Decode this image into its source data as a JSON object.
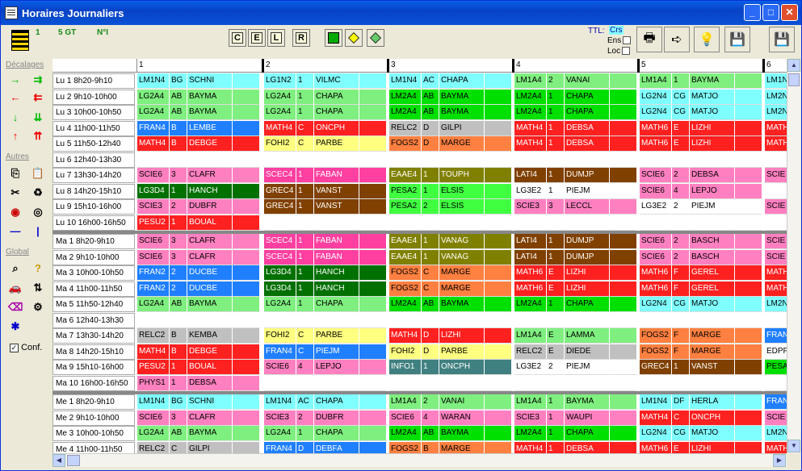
{
  "window": {
    "title": "Horaires Journaliers",
    "btn_min": "_",
    "btn_max": "□",
    "btn_close": "✕"
  },
  "toolbar": {
    "label1": "1",
    "label2": "5 GT",
    "label3": "N°I",
    "f_buttons": [
      "C",
      "E",
      "L",
      "R"
    ],
    "ttl": "TTL:",
    "crs": "Crs",
    "ens": "Ens",
    "loc": "Loc"
  },
  "left": {
    "decalages": "Décalages",
    "autres": "Autres",
    "global": "Global",
    "conf": "Conf."
  },
  "colors": {
    "cyan": "#7fffff",
    "mint": "#7fef7f",
    "green": "#00e000",
    "blue": "#1f7fff",
    "red": "#ff2020",
    "yellow": "#ffff80",
    "gray": "#c0c0c0",
    "orange": "#ff8040",
    "olive": "#808000",
    "pink": "#ff80c0",
    "dkgreen": "#007000",
    "brown": "#804000",
    "magenta": "#ff40a0",
    "teal": "#408080",
    "lgreen": "#40ff40"
  },
  "days": [
    {
      "label": "1"
    },
    {
      "label": "2"
    },
    {
      "label": "3"
    },
    {
      "label": "4"
    },
    {
      "label": "5"
    },
    {
      "label": "6"
    }
  ],
  "rows": [
    {
      "label": "Lu 1  8h20-9h10",
      "cells": [
        [
          "LM1N4",
          "BG",
          "SCHNI",
          "cyan"
        ],
        [
          "LG1N2",
          "1",
          "VILMC",
          "cyan"
        ],
        [
          "LM1N4",
          "AC",
          "CHAPA",
          "cyan"
        ],
        [
          "LM1A4",
          "2",
          "VANAI",
          "mint"
        ],
        [
          "LM1A4",
          "1",
          "BAYMA",
          "mint"
        ],
        [
          "LM1N",
          "",
          "",
          "cyan"
        ]
      ]
    },
    {
      "label": "Lu 2  9h10-10h00",
      "cells": [
        [
          "LG2A4",
          "AB",
          "BAYMA",
          "mint"
        ],
        [
          "LG2A4",
          "1",
          "CHAPA",
          "mint"
        ],
        [
          "LM2A4",
          "AB",
          "BAYMA",
          "green"
        ],
        [
          "LM2A4",
          "1",
          "CHAPA",
          "green"
        ],
        [
          "LG2N4",
          "CG",
          "MATJO",
          "cyan"
        ],
        [
          "LM2N",
          "",
          "",
          "cyan"
        ]
      ]
    },
    {
      "label": "Lu 3  10h00-10h50",
      "cells": [
        [
          "LG2A4",
          "AB",
          "BAYMA",
          "mint"
        ],
        [
          "LG2A4",
          "1",
          "CHAPA",
          "mint"
        ],
        [
          "LM2A4",
          "AB",
          "BAYMA",
          "green"
        ],
        [
          "LM2A4",
          "1",
          "CHAPA",
          "green"
        ],
        [
          "LG2N4",
          "CG",
          "MATJO",
          "cyan"
        ],
        [
          "LM2N",
          "",
          "",
          "cyan"
        ]
      ]
    },
    {
      "label": "Lu 4  11h00-11h50",
      "cells": [
        [
          "FRAN4",
          "B",
          "LEMBE",
          "blue"
        ],
        [
          "MATH4",
          "C",
          "ONCPH",
          "red"
        ],
        [
          "RELC2",
          "D",
          "GILPI",
          "gray"
        ],
        [
          "MATH4",
          "1",
          "DEBSA",
          "red"
        ],
        [
          "MATH6",
          "E",
          "LIZHI",
          "red"
        ],
        [
          "MATH",
          "",
          "",
          "red"
        ]
      ]
    },
    {
      "label": "Lu 5  11h50-12h40",
      "cells": [
        [
          "MATH4",
          "B",
          "DEBGE",
          "red"
        ],
        [
          "FOHI2",
          "C",
          "PARBE",
          "yellow"
        ],
        [
          "FOGS2",
          "D",
          "MARGE",
          "orange"
        ],
        [
          "MATH4",
          "1",
          "DEBSA",
          "red"
        ],
        [
          "MATH6",
          "E",
          "LIZHI",
          "red"
        ],
        [
          "MATH",
          "",
          "",
          "red"
        ]
      ]
    },
    {
      "label": "Lu 6  12h40-13h30",
      "cells": [
        [
          "",
          "",
          "",
          ""
        ],
        [
          "",
          "",
          "",
          ""
        ],
        [
          "",
          "",
          "",
          ""
        ],
        [
          "",
          "",
          "",
          ""
        ],
        [
          "",
          "",
          "",
          ""
        ],
        [
          "",
          "",
          "",
          ""
        ]
      ]
    },
    {
      "label": "Lu 7  13h30-14h20",
      "cells": [
        [
          "SCIE6",
          "3",
          "CLAFR",
          "pink"
        ],
        [
          "SCEC4",
          "1",
          "FABAN",
          "magenta"
        ],
        [
          "EAAE4",
          "1",
          "TOUPH",
          "olive"
        ],
        [
          "LATI4",
          "1",
          "DUMJP",
          "brown"
        ],
        [
          "SCIE6",
          "2",
          "DEBSA",
          "pink"
        ],
        [
          "SCIE",
          "",
          "",
          "pink"
        ]
      ]
    },
    {
      "label": "Lu 8  14h20-15h10",
      "cells": [
        [
          "LG3D4",
          "1",
          "HANCH",
          "dkgreen"
        ],
        [
          "GREC4",
          "1",
          "VANST",
          "brown"
        ],
        [
          "PESA2",
          "1",
          "ELSIS",
          "lgreen"
        ],
        [
          "LG3E2",
          "1",
          "PIEJM",
          ""
        ],
        [
          "SCIE6",
          "4",
          "LEPJO",
          "pink"
        ],
        [
          "",
          "",
          "",
          ""
        ]
      ]
    },
    {
      "label": "Lu 9  15h10-16h00",
      "cells": [
        [
          "SCIE3",
          "2",
          "DUBFR",
          "pink"
        ],
        [
          "GREC4",
          "1",
          "VANST",
          "brown"
        ],
        [
          "PESA2",
          "2",
          "ELSIS",
          "lgreen"
        ],
        [
          "SCIE3",
          "3",
          "LECCL",
          "pink"
        ],
        [
          "LG3E2",
          "2",
          "PIEJM",
          ""
        ],
        [
          "SCIE",
          "",
          "",
          "pink"
        ]
      ]
    },
    {
      "label": "Lu 10 16h00-16h50",
      "cells": [
        [
          "PESU2",
          "1",
          "BOUAL",
          "red"
        ],
        [
          "",
          "",
          "",
          ""
        ],
        [
          "",
          "",
          "",
          ""
        ],
        [
          "",
          "",
          "",
          ""
        ],
        [
          "",
          "",
          "",
          ""
        ],
        [
          "",
          "",
          "",
          ""
        ]
      ]
    },
    {
      "label": "Ma 1  8h20-9h10",
      "cells": [
        [
          "SCIE6",
          "3",
          "CLAFR",
          "pink"
        ],
        [
          "SCEC4",
          "1",
          "FABAN",
          "magenta"
        ],
        [
          "EAAE4",
          "1",
          "VANAG",
          "olive"
        ],
        [
          "LATI4",
          "1",
          "DUMJP",
          "brown"
        ],
        [
          "SCIE6",
          "2",
          "BASCH",
          "pink"
        ],
        [
          "SCIE",
          "",
          "",
          "pink"
        ]
      ],
      "sep": true
    },
    {
      "label": "Ma 2  9h10-10h00",
      "cells": [
        [
          "SCIE6",
          "3",
          "CLAFR",
          "pink"
        ],
        [
          "SCEC4",
          "1",
          "FABAN",
          "magenta"
        ],
        [
          "EAAE4",
          "1",
          "VANAG",
          "olive"
        ],
        [
          "LATI4",
          "1",
          "DUMJP",
          "brown"
        ],
        [
          "SCIE6",
          "2",
          "BASCH",
          "pink"
        ],
        [
          "SCIE",
          "",
          "",
          "pink"
        ]
      ]
    },
    {
      "label": "Ma 3  10h00-10h50",
      "cells": [
        [
          "FRAN2",
          "2",
          "DUCBE",
          "blue"
        ],
        [
          "LG3D4",
          "1",
          "HANCH",
          "dkgreen"
        ],
        [
          "FOGS2",
          "C",
          "MARGE",
          "orange"
        ],
        [
          "MATH6",
          "E",
          "LIZHI",
          "red"
        ],
        [
          "MATH6",
          "F",
          "GEREL",
          "red"
        ],
        [
          "MATH",
          "",
          "",
          "red"
        ]
      ]
    },
    {
      "label": "Ma 4  11h00-11h50",
      "cells": [
        [
          "FRAN2",
          "2",
          "DUCBE",
          "blue"
        ],
        [
          "LG3D4",
          "1",
          "HANCH",
          "dkgreen"
        ],
        [
          "FOGS2",
          "C",
          "MARGE",
          "orange"
        ],
        [
          "MATH6",
          "E",
          "LIZHI",
          "red"
        ],
        [
          "MATH6",
          "F",
          "GEREL",
          "red"
        ],
        [
          "MATH",
          "",
          "",
          "red"
        ]
      ]
    },
    {
      "label": "Ma 5  11h50-12h40",
      "cells": [
        [
          "LG2A4",
          "AB",
          "BAYMA",
          "mint"
        ],
        [
          "LG2A4",
          "1",
          "CHAPA",
          "mint"
        ],
        [
          "LM2A4",
          "AB",
          "BAYMA",
          "green"
        ],
        [
          "LM2A4",
          "1",
          "CHAPA",
          "green"
        ],
        [
          "LG2N4",
          "CG",
          "MATJO",
          "cyan"
        ],
        [
          "LM2N",
          "",
          "",
          "cyan"
        ]
      ]
    },
    {
      "label": "Ma 6  12h40-13h30",
      "cells": [
        [
          "",
          "",
          "",
          ""
        ],
        [
          "",
          "",
          "",
          ""
        ],
        [
          "",
          "",
          "",
          ""
        ],
        [
          "",
          "",
          "",
          ""
        ],
        [
          "",
          "",
          "",
          ""
        ],
        [
          "",
          "",
          "",
          ""
        ]
      ]
    },
    {
      "label": "Ma 7  13h30-14h20",
      "cells": [
        [
          "RELC2",
          "B",
          "KEMBA",
          "gray"
        ],
        [
          "FOHI2",
          "C",
          "PARBE",
          "yellow"
        ],
        [
          "MATH4",
          "D",
          "LIZHI",
          "red"
        ],
        [
          "LM1A4",
          "E",
          "LAMMA",
          "mint"
        ],
        [
          "FOGS2",
          "F",
          "MARGE",
          "orange"
        ],
        [
          "FRAN",
          "",
          "",
          "blue"
        ]
      ]
    },
    {
      "label": "Ma 8  14h20-15h10",
      "cells": [
        [
          "MATH4",
          "B",
          "DEBGE",
          "red"
        ],
        [
          "FRAN4",
          "C",
          "PIEJM",
          "blue"
        ],
        [
          "FOHI2",
          "D",
          "PARBE",
          "yellow"
        ],
        [
          "RELC2",
          "E",
          "DIEDE",
          "gray"
        ],
        [
          "FOGS2",
          "F",
          "MARGE",
          "orange"
        ],
        [
          "EDPF",
          "",
          "",
          ""
        ]
      ]
    },
    {
      "label": "Ma 9  15h10-16h00",
      "cells": [
        [
          "PESU2",
          "1",
          "BOUAL",
          "red"
        ],
        [
          "SCIE6",
          "4",
          "LEPJO",
          "pink"
        ],
        [
          "INFO1",
          "1",
          "ONCPH",
          "teal"
        ],
        [
          "LG3E2",
          "2",
          "PIEJM",
          ""
        ],
        [
          "GREC4",
          "1",
          "VANST",
          "brown"
        ],
        [
          "PESA",
          "",
          "",
          "green"
        ]
      ]
    },
    {
      "label": "Ma 10 16h00-16h50",
      "cells": [
        [
          "PHYS1",
          "1",
          "DEBSA",
          "pink"
        ],
        [
          "",
          "",
          "",
          ""
        ],
        [
          "",
          "",
          "",
          ""
        ],
        [
          "",
          "",
          "",
          ""
        ],
        [
          "",
          "",
          "",
          ""
        ],
        [
          "",
          "",
          "",
          ""
        ]
      ]
    },
    {
      "label": "Me 1  8h20-9h10",
      "cells": [
        [
          "LM1N4",
          "BG",
          "SCHNI",
          "cyan"
        ],
        [
          "LM1N4",
          "AC",
          "CHAPA",
          "cyan"
        ],
        [
          "LM1A4",
          "2",
          "VANAI",
          "mint"
        ],
        [
          "LM1A4",
          "1",
          "BAYMA",
          "mint"
        ],
        [
          "LM1N4",
          "DF",
          "HERLA",
          "cyan"
        ],
        [
          "FRAN",
          "",
          "",
          "blue"
        ]
      ],
      "sep": true
    },
    {
      "label": "Me 2  9h10-10h00",
      "cells": [
        [
          "SCIE6",
          "3",
          "CLAFR",
          "pink"
        ],
        [
          "SCIE3",
          "2",
          "DUBFR",
          "pink"
        ],
        [
          "SCIE6",
          "4",
          "WARAN",
          "pink"
        ],
        [
          "SCIE3",
          "1",
          "WAUPI",
          "pink"
        ],
        [
          "MATH4",
          "C",
          "ONCPH",
          "red"
        ],
        [
          "SCIE",
          "",
          "",
          "pink"
        ]
      ]
    },
    {
      "label": "Me 3  10h00-10h50",
      "cells": [
        [
          "LG2A4",
          "AB",
          "BAYMA",
          "mint"
        ],
        [
          "LG2A4",
          "1",
          "CHAPA",
          "mint"
        ],
        [
          "LM2A4",
          "AB",
          "BAYMA",
          "green"
        ],
        [
          "LM2A4",
          "1",
          "CHAPA",
          "green"
        ],
        [
          "LG2N4",
          "CG",
          "MATJO",
          "cyan"
        ],
        [
          "LM2N",
          "",
          "",
          "cyan"
        ]
      ]
    },
    {
      "label": "Me 4  11h00-11h50",
      "cells": [
        [
          "RELC2",
          "C",
          "GILPI",
          "gray"
        ],
        [
          "FRAN4",
          "D",
          "DEBFA",
          "blue"
        ],
        [
          "FOGS2",
          "B",
          "MARGE",
          "orange"
        ],
        [
          "MATH4",
          "1",
          "DEBSA",
          "red"
        ],
        [
          "MATH6",
          "E",
          "LIZHI",
          "red"
        ],
        [
          "MATH",
          "",
          "",
          "red"
        ]
      ]
    }
  ]
}
